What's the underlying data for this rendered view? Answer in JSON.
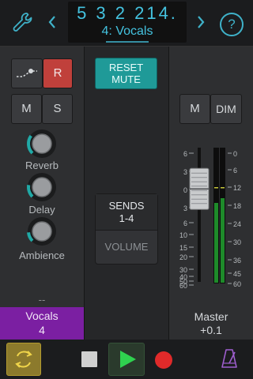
{
  "header": {
    "position": "5  3  2  214.",
    "track": "4: Vocals",
    "icons": [
      "wrench-icon",
      "chevron-left-icon",
      "chevron-right-icon",
      "help-icon"
    ],
    "help_glyph": "?",
    "accent_color": "#44c3e0"
  },
  "channel": {
    "automation_icon": "automation-icon",
    "record_label": "R",
    "mute_label": "M",
    "solo_label": "S",
    "knobs": [
      {
        "label": "Reverb",
        "value": 0.3
      },
      {
        "label": "Delay",
        "value": 0.2
      },
      {
        "label": "Ambience",
        "value": 0.15
      }
    ],
    "empty_slot": "--",
    "track_name": "Vocals",
    "track_number": "4",
    "track_color": "#7b1fa2"
  },
  "middle": {
    "reset_mute_line1": "RESET",
    "reset_mute_line2": "MUTE",
    "sends_line1": "SENDS",
    "sends_line2": "1-4",
    "volume_label": "VOLUME"
  },
  "master": {
    "mute_label": "M",
    "dim_label": "DIM",
    "fader_scale": [
      "6",
      "3",
      "0",
      "3",
      "6",
      "10",
      "15",
      "20",
      "30",
      "40",
      "50",
      "60"
    ],
    "meter_scale": [
      "0",
      "6",
      "12",
      "18",
      "24",
      "30",
      "36",
      "45",
      "60"
    ],
    "fader_value_db": 0.1,
    "label": "Master",
    "value": "+0.1"
  },
  "transport": {
    "icons": [
      "cycle-icon",
      "stop-icon",
      "play-icon",
      "record-icon",
      "metronome-icon"
    ],
    "cycle_active": true
  }
}
